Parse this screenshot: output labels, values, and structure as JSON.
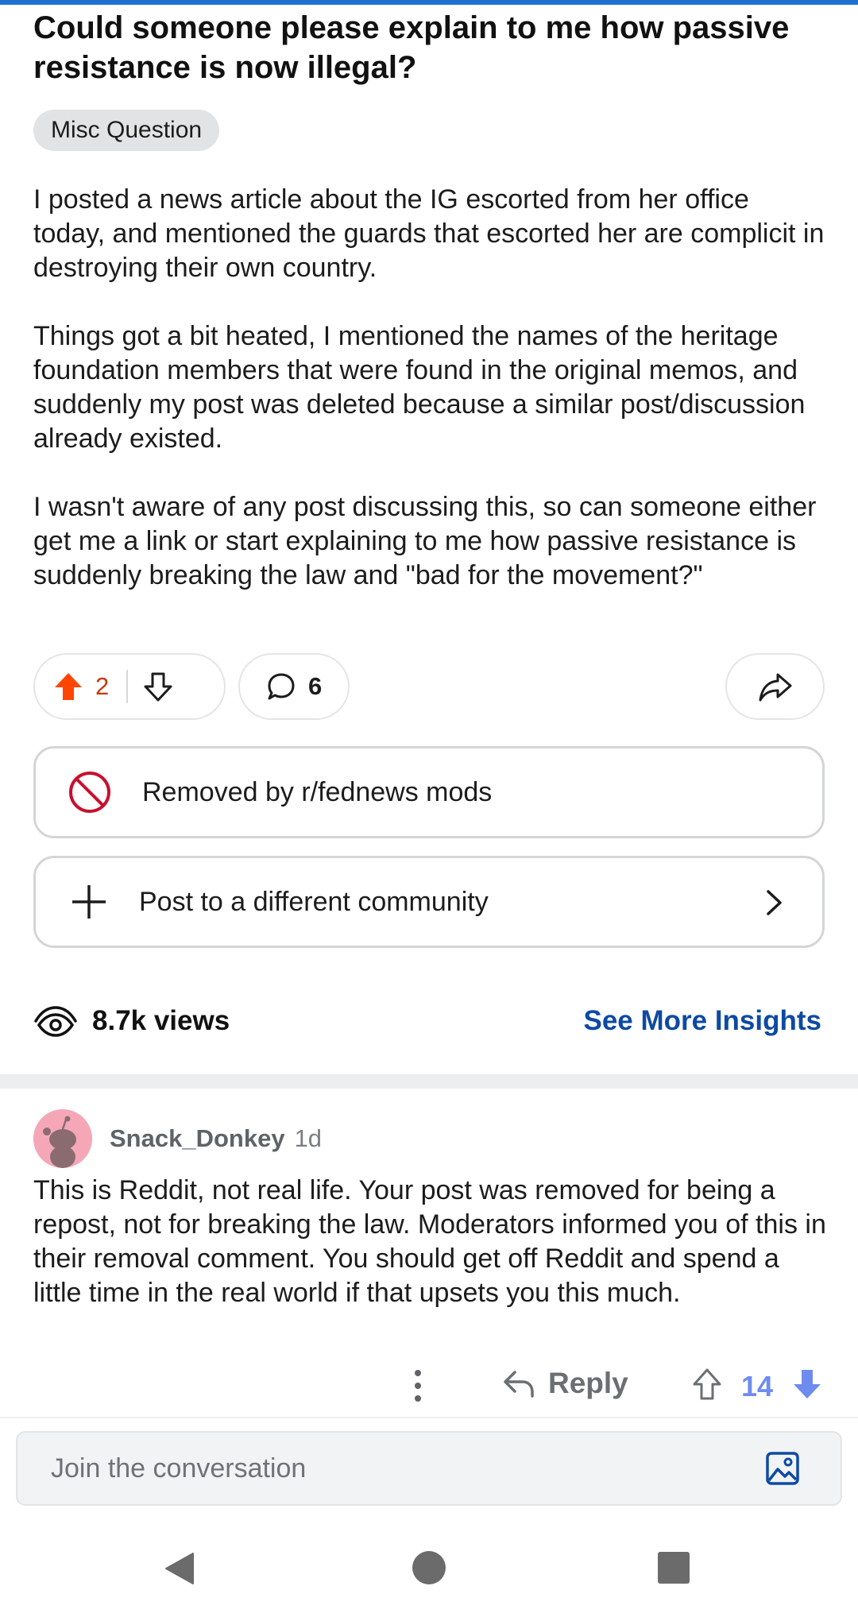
{
  "post": {
    "title": "Could someone please explain to me how passive resistance is now illegal?",
    "flair": "Misc Question",
    "paragraphs": [
      "I posted a news article about the IG escorted from her office today, and mentioned the guards that escorted her are complicit in destroying their own country.",
      "Things got a bit heated, I mentioned the names of the heritage foundation members that were found in the original memos, and suddenly my post was deleted because a similar post/discussion already existed.",
      "I wasn't aware of any post discussing this, so can someone either get me a link or start explaining to me how passive resistance is suddenly breaking the law and \"bad for the movement?\""
    ],
    "score": "2",
    "comment_count": "6",
    "removed_label": "Removed by r/fednews mods",
    "crosspost_label": "Post to a different community",
    "views": "8.7k views",
    "insights_label": "See More Insights"
  },
  "comment": {
    "username": "Snack_Donkey",
    "time": "1d",
    "body": "This is Reddit, not real life. Your post was removed for being a repost, not for breaking the law. Moderators informed you of this in their removal comment. You should get off Reddit and spend a little time in the real world if that upsets you this much.",
    "reply_label": "Reply",
    "score": "14"
  },
  "composer": {
    "placeholder": "Join the conversation"
  },
  "colors": {
    "accent_blue": "#0d4aa3",
    "upvote_orange": "#ff4500",
    "removed_red": "#c8102e",
    "comment_vote_blue": "#6e8cf0"
  },
  "icons": [
    "upvote-icon",
    "downvote-icon",
    "comment-icon",
    "share-icon",
    "removed-icon",
    "plus-icon",
    "chevron-right-icon",
    "views-icon",
    "more-vertical-icon",
    "reply-icon",
    "image-icon",
    "nav-back-icon",
    "nav-home-icon",
    "nav-recents-icon"
  ]
}
